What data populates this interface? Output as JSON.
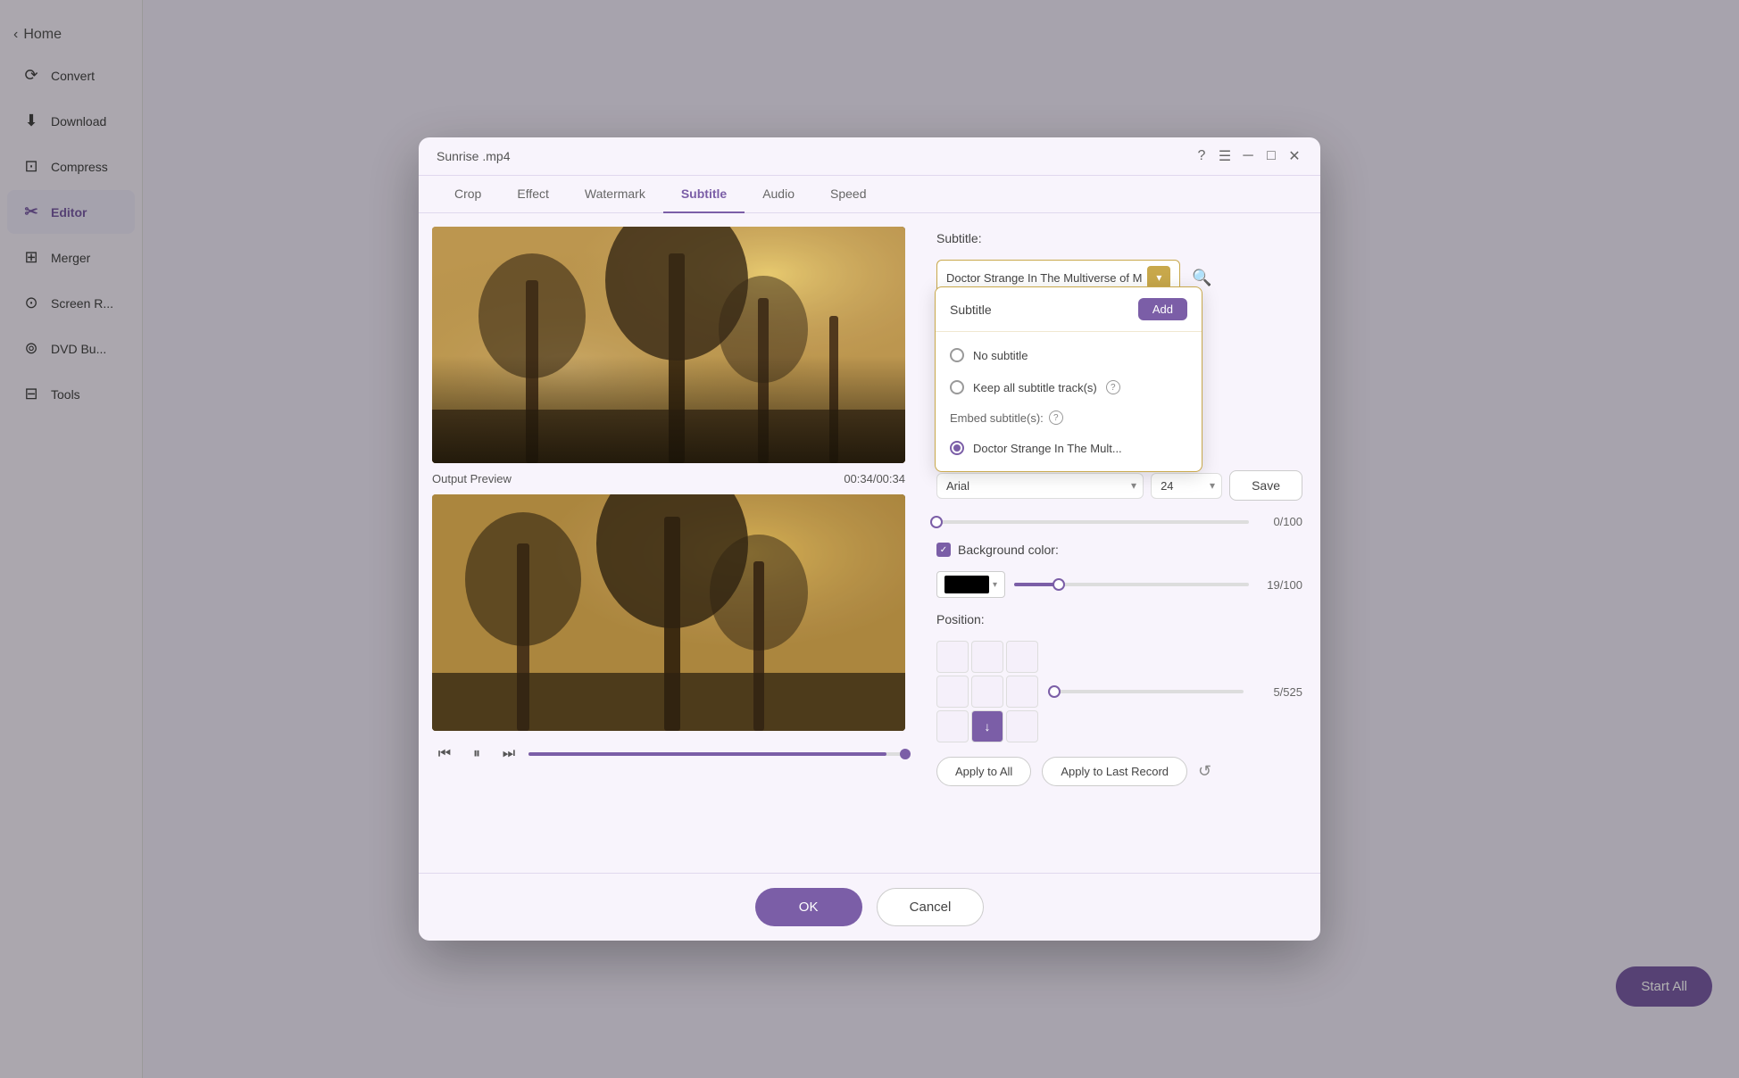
{
  "app": {
    "title": "Sunrise .mp4",
    "window_controls": [
      "close",
      "minimize",
      "maximize",
      "close2"
    ]
  },
  "sidebar": {
    "back_label": "Home",
    "items": [
      {
        "id": "convert",
        "label": "Convert",
        "icon": "⟳"
      },
      {
        "id": "download",
        "label": "Download",
        "icon": "⬇"
      },
      {
        "id": "compress",
        "label": "Compress",
        "icon": "⊡"
      },
      {
        "id": "editor",
        "label": "Editor",
        "icon": "✂",
        "active": true
      },
      {
        "id": "merger",
        "label": "Merger",
        "icon": "⊞"
      },
      {
        "id": "screen",
        "label": "Screen R...",
        "icon": "⊙"
      },
      {
        "id": "dvd",
        "label": "DVD Bu...",
        "icon": "⊚"
      },
      {
        "id": "tools",
        "label": "Tools",
        "icon": "⊟"
      }
    ]
  },
  "modal": {
    "tabs": [
      {
        "id": "crop",
        "label": "Crop"
      },
      {
        "id": "effect",
        "label": "Effect"
      },
      {
        "id": "watermark",
        "label": "Watermark"
      },
      {
        "id": "subtitle",
        "label": "Subtitle",
        "active": true
      },
      {
        "id": "audio",
        "label": "Audio"
      },
      {
        "id": "speed",
        "label": "Speed"
      }
    ],
    "video": {
      "output_label": "Output Preview",
      "timestamp": "00:34/00:34"
    },
    "subtitle_panel": {
      "label": "Subtitle:",
      "selected_text": "Doctor Strange In The Multiverse of M",
      "dropdown": {
        "header_label": "Subtitle",
        "add_button": "Add",
        "options": [
          {
            "id": "no_subtitle",
            "label": "No subtitle",
            "selected": false
          },
          {
            "id": "keep_all",
            "label": "Keep all subtitle track(s)",
            "selected": false,
            "has_help": true
          },
          {
            "id": "embed_label",
            "label": "Embed subtitle(s):",
            "is_section": true,
            "has_help": true
          },
          {
            "id": "doctor_strange",
            "label": "Doctor Strange In The Mult...",
            "selected": true
          }
        ]
      },
      "opacity_value": "0/100",
      "background_color_label": "Background color:",
      "background_checked": true,
      "bg_slider_value": "19/100",
      "bg_slider_percent": 19,
      "position_label": "Position:",
      "position_slider_value": "5/525",
      "position_slider_percent": 1,
      "apply_all_label": "Apply to All",
      "apply_last_label": "Apply to Last Record",
      "ok_label": "OK",
      "cancel_label": "Cancel"
    },
    "save_label": "Save"
  },
  "start_all_label": "Start All"
}
